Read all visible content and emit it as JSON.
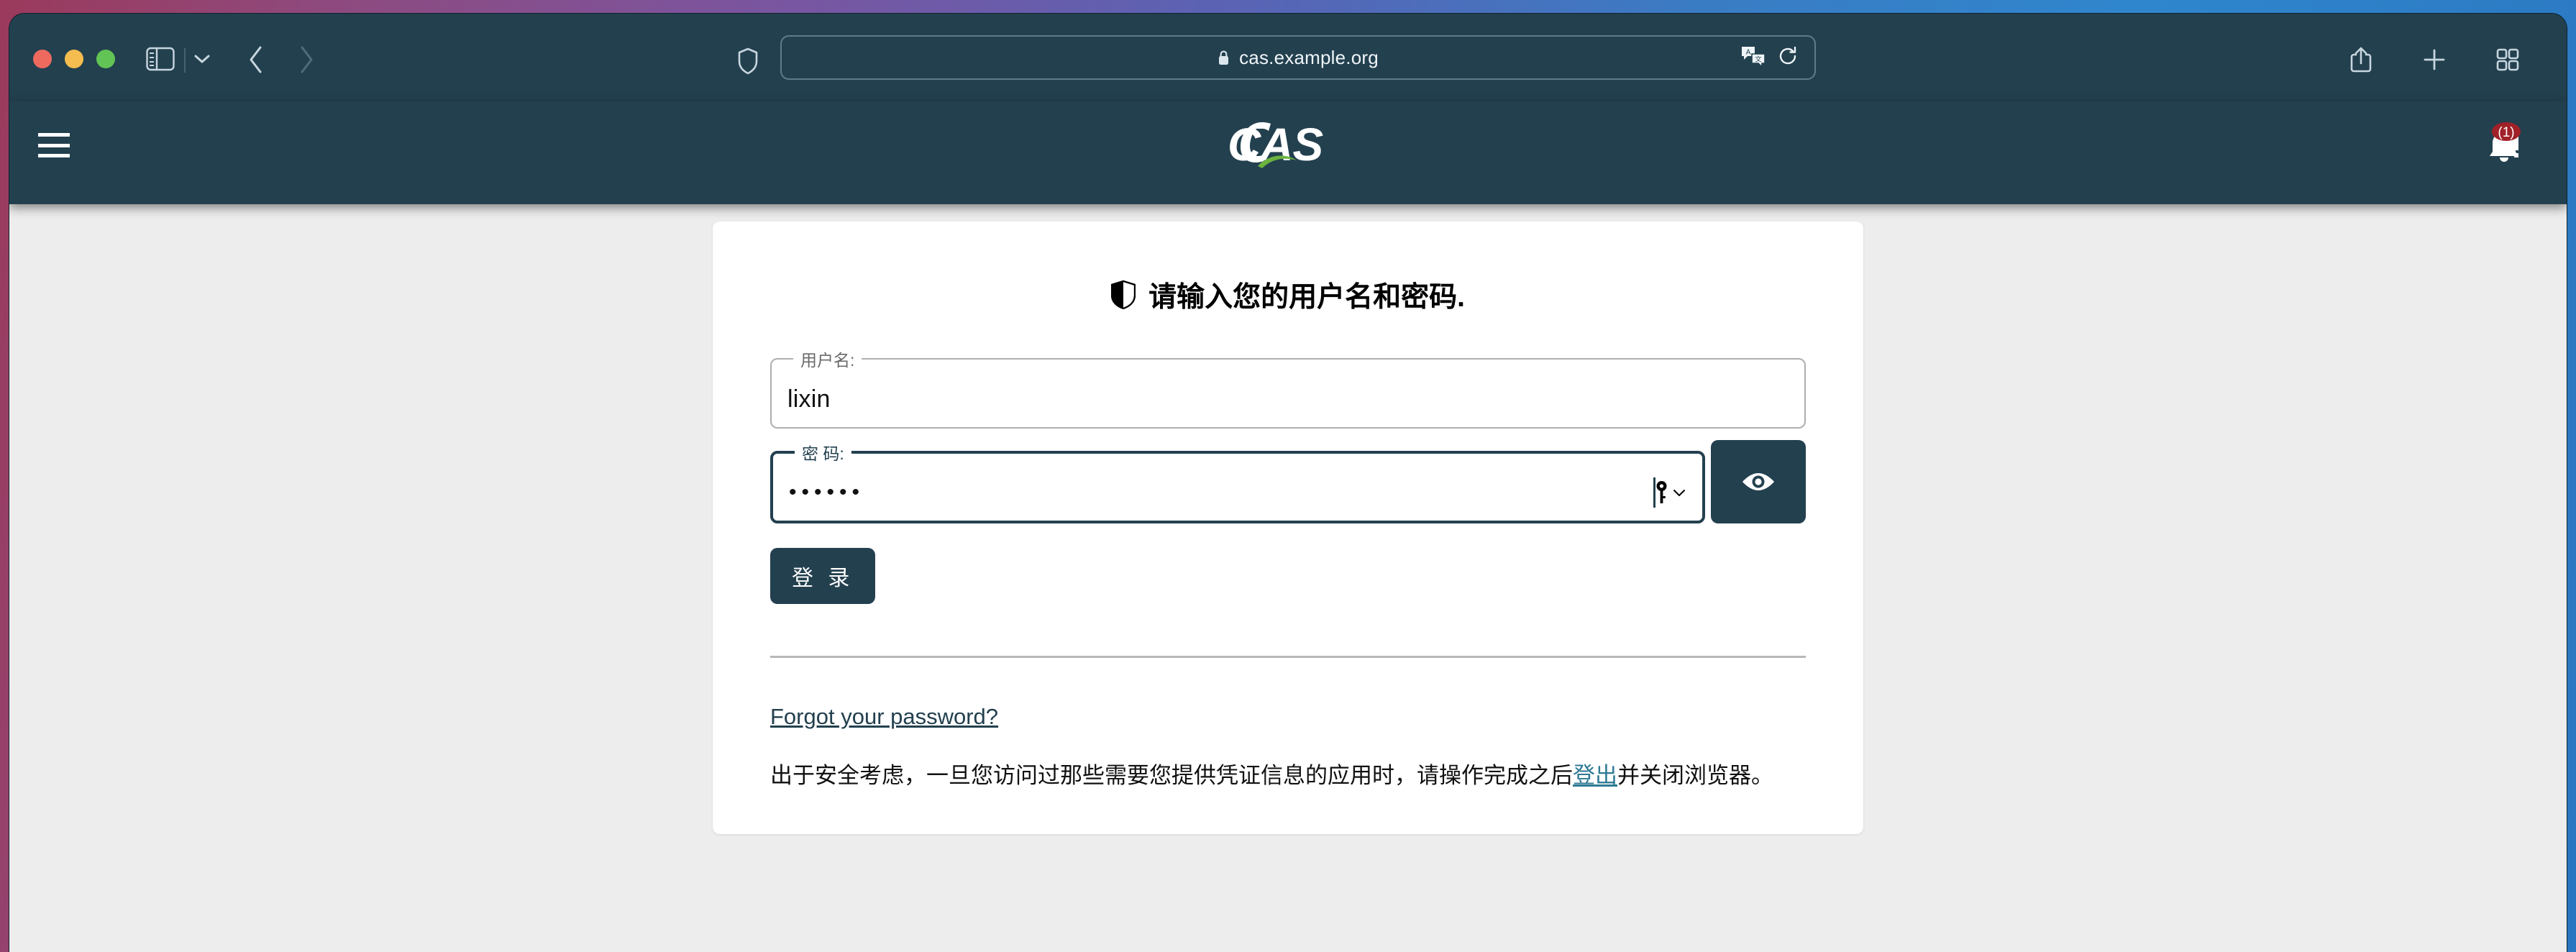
{
  "browser": {
    "url": "cas.example.org",
    "lock_icon": "lock-icon",
    "traffic_lights": [
      "close",
      "minimize",
      "zoom"
    ],
    "sidebar_icon": "sidebar-toggle-icon",
    "chevron_icon": "chevron-down-icon",
    "back_icon": "back-arrow-icon",
    "forward_icon": "forward-arrow-icon",
    "shield_icon": "privacy-shield-icon",
    "translate_icon": "translate-icon",
    "reload_icon": "reload-icon",
    "share_icon": "share-icon",
    "new_tab_icon": "plus-icon",
    "tab_overview_icon": "tab-overview-icon",
    "colors": {
      "chrome": "#23404f",
      "chrome_text": "#c7d6de"
    }
  },
  "site_header": {
    "menu_icon": "hamburger-menu-icon",
    "logo_text": "CAS",
    "logo_accent_color": "#6cb33f",
    "bell_icon": "notification-bell-icon",
    "bell_badge": "(1)",
    "bell_badge_color": "#a02128",
    "background": "#23404f"
  },
  "login": {
    "title": "请输入您的用户名和密码.",
    "title_icon": "shield-icon",
    "username": {
      "label": "用户名:",
      "value": "lixin",
      "placeholder": ""
    },
    "password": {
      "label": "密 码:",
      "value": "••••••",
      "placeholder": "",
      "autofill_icon": "key-icon",
      "autofill_chevron": "chevron-down-icon",
      "reveal_icon": "eye-icon"
    },
    "submit_label": "登 录",
    "forgot_link": "Forgot your password?",
    "notice_before": "出于安全考虑，一旦您访问过那些需要您提供凭证信息的应用时，请操作完成之后",
    "notice_link": "登出",
    "notice_after": "并关闭浏览器。",
    "accent_color": "#23404f",
    "link_color": "#2f7a94"
  }
}
